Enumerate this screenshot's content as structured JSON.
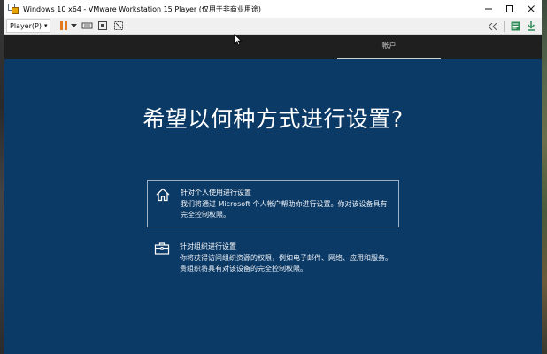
{
  "window": {
    "title": "Windows 10 x64 - VMware Workstation 15 Player (仅用于非商业用途)"
  },
  "toolbar": {
    "player_label": "Player(P)",
    "dropdown_glyph": "▾"
  },
  "vm": {
    "tab_label": "帐户",
    "headline": "希望以何种方式进行设置?",
    "options": [
      {
        "title": "针对个人使用进行设置",
        "description": "我们将通过 Microsoft 个人帐户帮助你进行设置。你对该设备具有完全控制权限。",
        "icon": "home-icon"
      },
      {
        "title": "针对组织进行设置",
        "description": "你将获得访问组织资源的权限，例如电子邮件、网络、应用和服务。贵组织将具有对该设备的完全控制权限。",
        "icon": "briefcase-icon"
      }
    ]
  },
  "colors": {
    "vm_background": "#0c3a66",
    "vm_topbar": "#1f1f1f",
    "pause_orange": "#e27a1e"
  }
}
